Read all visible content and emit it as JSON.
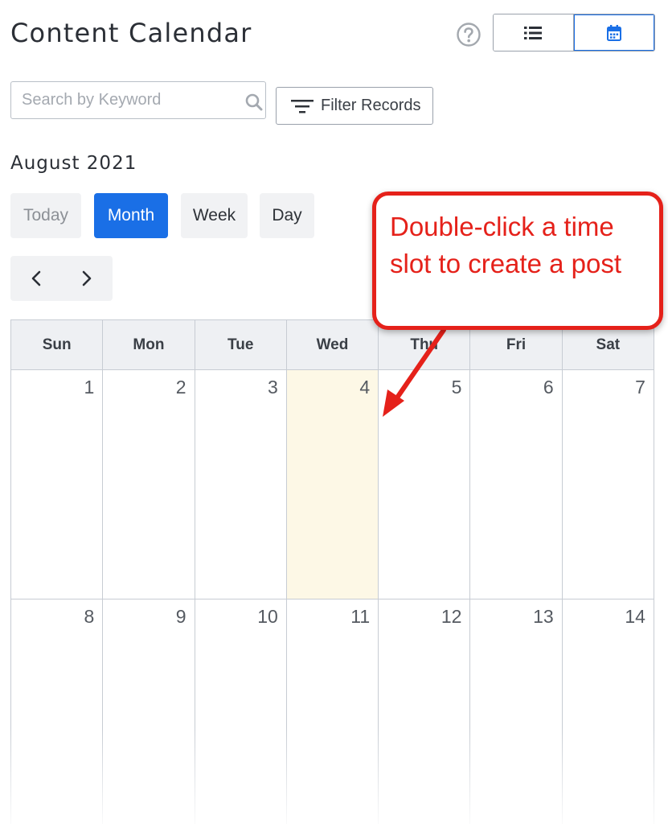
{
  "header": {
    "title": "Content Calendar",
    "help_icon": "question-circle-icon",
    "view_toggle": [
      {
        "icon": "list-icon",
        "active": false
      },
      {
        "icon": "calendar-icon",
        "active": true
      }
    ]
  },
  "toolbar": {
    "search_placeholder": "Search by Keyword",
    "search_value": "",
    "filter_label": "Filter Records"
  },
  "calendar": {
    "month_label": "August 2021",
    "range_buttons": {
      "today": "Today",
      "month": "Month",
      "week": "Week",
      "day": "Day"
    },
    "active_range": "Month",
    "weekdays": [
      "Sun",
      "Mon",
      "Tue",
      "Wed",
      "Thu",
      "Fri",
      "Sat"
    ],
    "weeks": [
      [
        "1",
        "2",
        "3",
        "4",
        "5",
        "6",
        "7"
      ],
      [
        "8",
        "9",
        "10",
        "11",
        "12",
        "13",
        "14"
      ]
    ],
    "today": "4"
  },
  "annotation": {
    "text": "Double-click a time slot to create a post"
  },
  "colors": {
    "accent": "#1a6fe6",
    "today_bg": "#fdf8e6",
    "annotation_red": "#e5211a"
  }
}
